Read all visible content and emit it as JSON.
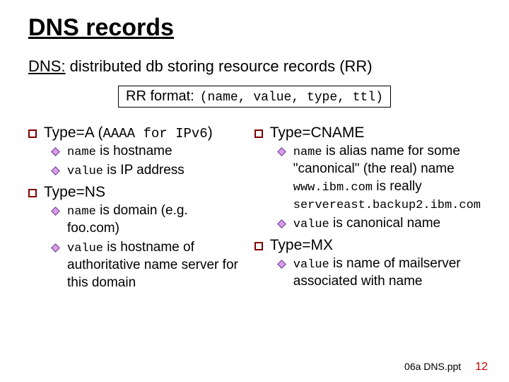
{
  "title": "DNS records",
  "subtitle": {
    "u1": "DNS:",
    "rest": " distributed db storing resource records (RR)"
  },
  "rr_format": {
    "label": "RR format:",
    "tuple": "(name, value, type, ttl)"
  },
  "left": {
    "a": {
      "label_pre": "Type=A (",
      "label_mono": "AAAA for IPv6",
      "label_post": ")",
      "b1_mono": "name",
      "b1_rest": " is hostname",
      "b2_mono": "value",
      "b2_rest": " is IP address"
    },
    "ns": {
      "label": "Type=NS",
      "b1_mono": "name",
      "b1_rest": " is domain (e.g. foo.com)",
      "b2_mono": "value",
      "b2_rest": " is hostname of authoritative name server for this domain"
    }
  },
  "right": {
    "cname": {
      "label": "Type=CNAME",
      "b1_mono": "name",
      "b1_rest": " is alias name for some \"canonical\" (the real) name",
      "ex1": "www.ibm.com",
      "ex_mid": " is really",
      "ex2": "servereast.backup2.ibm.com",
      "b2_mono": "value",
      "b2_rest": " is canonical name"
    },
    "mx": {
      "label": "Type=MX",
      "b1_mono": "value",
      "b1_rest": " is name of mailserver associated with name"
    }
  },
  "footer": {
    "file": "06a DNS.ppt",
    "page": "12"
  }
}
